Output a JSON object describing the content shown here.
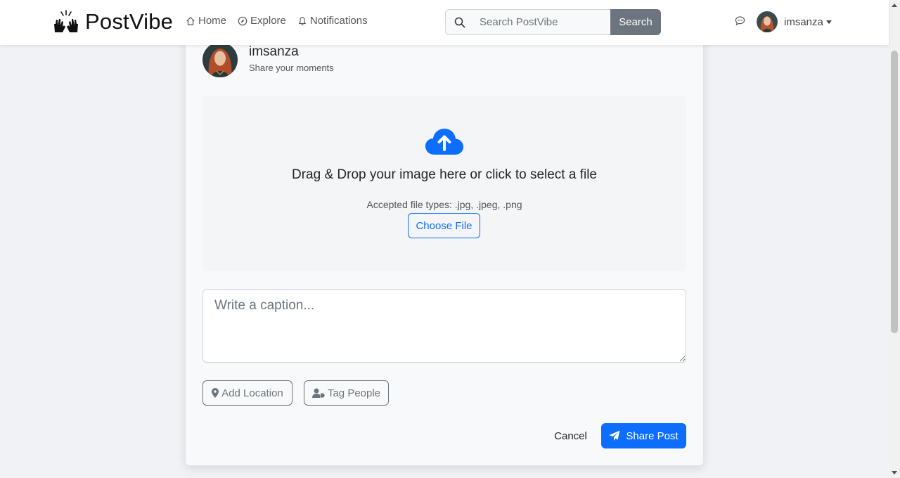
{
  "colors": {
    "primary": "#0d6efd",
    "secondary": "#6c757d",
    "page_bg": "#f0f2f5",
    "card_bg": "#f8f9fa"
  },
  "navbar": {
    "brand_name": "PostVibe",
    "brand_icon": "hands-icon",
    "links": [
      {
        "label": "Home",
        "icon": "house-icon"
      },
      {
        "label": "Explore",
        "icon": "compass-icon"
      },
      {
        "label": "Notifications",
        "icon": "bell-icon"
      }
    ],
    "search": {
      "placeholder": "Search PostVibe",
      "value": "",
      "button_label": "Search",
      "icon": "search-icon"
    },
    "chat_icon": "chat-bubble-icon",
    "user": {
      "username": "imsanza"
    }
  },
  "card": {
    "username": "imsanza",
    "subtitle": "Share your moments",
    "dropzone": {
      "icon": "cloud-upload-icon",
      "title": "Drag & Drop your image here or click to select a file",
      "accepted_types": "Accepted file types: .jpg, .jpeg, .png",
      "choose_label": "Choose File"
    },
    "caption_placeholder": "Write a caption...",
    "caption_value": "",
    "add_location_label": "Add Location",
    "tag_people_label": "Tag People",
    "cancel_label": "Cancel",
    "share_label": "Share Post"
  }
}
